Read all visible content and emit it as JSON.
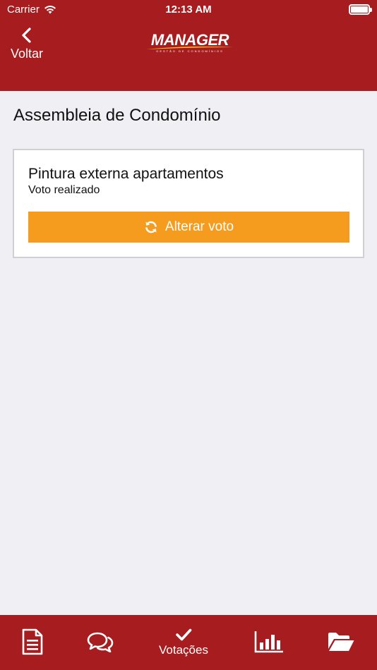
{
  "status_bar": {
    "carrier": "Carrier",
    "time": "12:13 AM",
    "battery_level": 1.0
  },
  "header": {
    "back_label": "Voltar",
    "logo_text": "MANAGER",
    "logo_tagline": "GESTÃO DE CONDOMÍNIOS",
    "background_color": "#a61c1f"
  },
  "main": {
    "title": "Assembleia de Condomínio",
    "card": {
      "title": "Pintura externa apartamentos",
      "status": "Voto realizado",
      "button_label": "Alterar voto",
      "button_icon": "refresh-icon",
      "button_color": "#f59b1d"
    }
  },
  "tabbar": {
    "items": [
      {
        "icon": "document-icon",
        "label": ""
      },
      {
        "icon": "chat-icon",
        "label": ""
      },
      {
        "icon": "check-icon",
        "label": "Votações"
      },
      {
        "icon": "bar-chart-icon",
        "label": ""
      },
      {
        "icon": "folder-open-icon",
        "label": ""
      }
    ]
  }
}
